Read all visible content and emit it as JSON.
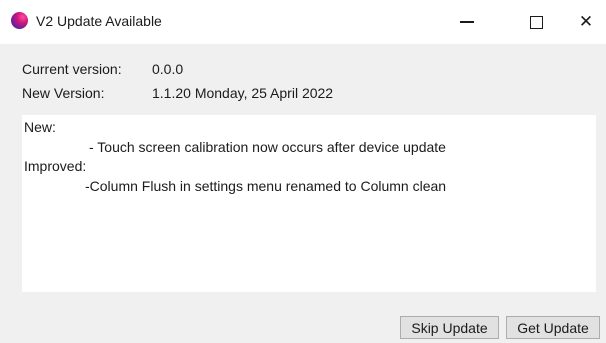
{
  "window": {
    "title": "V2 Update Available",
    "icon": "app-orb-icon",
    "controls": {
      "minimize_icon": "minimize-icon",
      "maximize_icon": "maximize-icon",
      "close_icon": "close-icon",
      "close_glyph": "✕"
    }
  },
  "info": {
    "current_label": "Current version:",
    "current_value": "0.0.0",
    "new_label": "New Version:",
    "new_value": "1.1.20 Monday, 25 April 2022"
  },
  "notes": {
    "lines": [
      "New:",
      "- Touch screen calibration now occurs after device update",
      "Improved:",
      "-Column Flush in settings menu renamed to Column clean"
    ]
  },
  "actions": {
    "skip_label": "Skip Update",
    "get_label": "Get Update"
  },
  "colors": {
    "window_bg": "#f0f0f0",
    "titlebar_bg": "#ffffff",
    "notes_bg": "#ffffff",
    "button_bg": "#e1e1e1",
    "button_border": "#adadad"
  }
}
